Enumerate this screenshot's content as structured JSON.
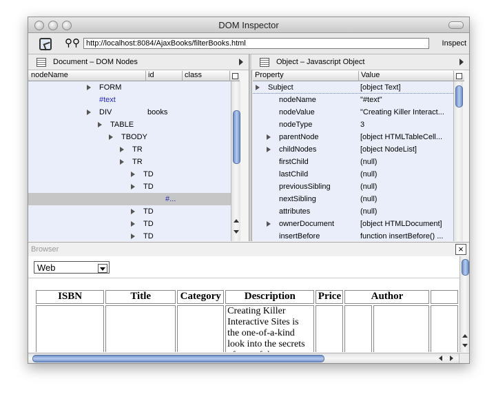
{
  "window": {
    "title": "DOM Inspector"
  },
  "toolbar": {
    "url": "http://localhost:8084/AjaxBooks/filterBooks.html",
    "inspect_label": "Inspect"
  },
  "left_pane": {
    "title": "Document – DOM Nodes",
    "columns": [
      "nodeName",
      "id",
      "class"
    ],
    "rows": [
      {
        "name": "FORM",
        "id": "",
        "level": 3,
        "twisty": true,
        "blue": false
      },
      {
        "name": "#text",
        "id": "",
        "level": 3,
        "twisty": false,
        "blue": true
      },
      {
        "name": "DIV",
        "id": "books",
        "level": 3,
        "twisty": true,
        "blue": false
      },
      {
        "name": "TABLE",
        "id": "",
        "level": 4,
        "twisty": true,
        "blue": false
      },
      {
        "name": "TBODY",
        "id": "",
        "level": 5,
        "twisty": true,
        "blue": false
      },
      {
        "name": "TR",
        "id": "",
        "level": 6,
        "twisty": true,
        "blue": false
      },
      {
        "name": "TR",
        "id": "",
        "level": 6,
        "twisty": true,
        "blue": false
      },
      {
        "name": "TD",
        "id": "",
        "level": 7,
        "twisty": true,
        "blue": false
      },
      {
        "name": "TD",
        "id": "",
        "level": 7,
        "twisty": true,
        "blue": false
      },
      {
        "name": "#...",
        "id": "",
        "level": 9,
        "twisty": false,
        "blue": true,
        "selected": true
      },
      {
        "name": "TD",
        "id": "",
        "level": 7,
        "twisty": true,
        "blue": false
      },
      {
        "name": "TD",
        "id": "",
        "level": 7,
        "twisty": true,
        "blue": false
      },
      {
        "name": "TD",
        "id": "",
        "level": 7,
        "twisty": true,
        "blue": false
      }
    ]
  },
  "right_pane": {
    "title": "Object – Javascript Object",
    "columns": [
      "Property",
      "Value"
    ],
    "rows": [
      {
        "prop": "Subject",
        "value": "[object Text]",
        "twisty": true,
        "indent": 0
      },
      {
        "prop": "nodeName",
        "value": "\"#text\"",
        "twisty": false,
        "indent": 1
      },
      {
        "prop": "nodeValue",
        "value": "\"Creating Killer Interact...",
        "twisty": false,
        "indent": 1
      },
      {
        "prop": "nodeType",
        "value": "3",
        "twisty": false,
        "indent": 1
      },
      {
        "prop": "parentNode",
        "value": "[object HTMLTableCell...",
        "twisty": true,
        "indent": 1
      },
      {
        "prop": "childNodes",
        "value": "[object NodeList]",
        "twisty": true,
        "indent": 1
      },
      {
        "prop": "firstChild",
        "value": "(null)",
        "twisty": false,
        "indent": 1
      },
      {
        "prop": "lastChild",
        "value": "(null)",
        "twisty": false,
        "indent": 1
      },
      {
        "prop": "previousSibling",
        "value": "(null)",
        "twisty": false,
        "indent": 1
      },
      {
        "prop": "nextSibling",
        "value": "(null)",
        "twisty": false,
        "indent": 1
      },
      {
        "prop": "attributes",
        "value": "(null)",
        "twisty": false,
        "indent": 1
      },
      {
        "prop": "ownerDocument",
        "value": "[object HTMLDocument]",
        "twisty": true,
        "indent": 1
      },
      {
        "prop": "insertBefore",
        "value": "function insertBefore() ...",
        "twisty": false,
        "indent": 1
      }
    ]
  },
  "browser": {
    "title": "Browser",
    "select_value": "Web",
    "table_headers": [
      "ISBN",
      "Title",
      "Category",
      "Description",
      "Price",
      "Author",
      ""
    ],
    "description_text": "Creating Killer Interactive Sites is the one-of-a-kind look into the secrets of one of the"
  }
}
